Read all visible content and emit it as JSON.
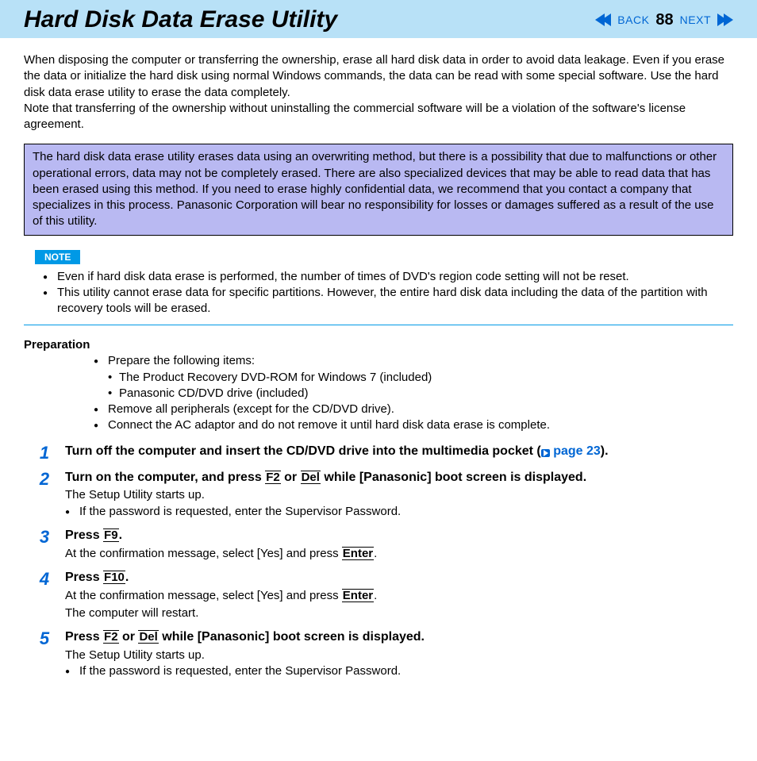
{
  "header": {
    "title": "Hard Disk Data Erase Utility",
    "back_label": "BACK",
    "page_number": "88",
    "next_label": "NEXT"
  },
  "intro_p1": "When disposing the computer or transferring the ownership, erase all hard disk data in order to avoid data leakage. Even if you erase the data or initialize the hard disk using normal Windows commands, the data can be read with some special software. Use the hard disk data erase utility to erase the data completely.",
  "intro_p2": "Note that transferring of the ownership without uninstalling the commercial software will be a violation of the software's license agreement.",
  "warning": "The hard disk data erase utility erases data using an overwriting method, but there is a possibility that due to malfunctions or other operational errors, data may not be completely erased. There are also specialized devices that may be able to read data that has been erased using this method. If you need to erase highly confidential data, we recommend that you contact a company that specializes in this process. Panasonic Corporation will bear no responsibility for losses or damages suffered as a result of the use of this utility.",
  "note_tag": "NOTE",
  "notes": [
    "Even if hard disk data erase is performed, the number of times of DVD's region code setting will not be reset.",
    "This utility cannot erase data for specific partitions. However, the entire hard disk data including the data of the partition with recovery tools will be erased."
  ],
  "prep": {
    "heading": "Preparation",
    "items_intro": "Prepare the following items:",
    "sub_items": [
      "The Product Recovery DVD-ROM for Windows 7 (included)",
      "Panasonic CD/DVD drive (included)"
    ],
    "item2": "Remove all peripherals (except for the CD/DVD drive).",
    "item3": "Connect the AC adaptor and do not remove it until hard disk data erase is complete."
  },
  "steps": {
    "s1": {
      "num": "1",
      "before_link": "Turn off the computer and insert the CD/DVD drive into the multimedia pocket (",
      "link_text": " page 23",
      "after_link": ")."
    },
    "s2": {
      "num": "2",
      "t_a": "Turn on the computer, and press ",
      "key1": "F2",
      "t_b": " or ",
      "key2": "Del",
      "t_c": " while [Panasonic] boot screen is displayed.",
      "sub1": "The Setup Utility starts up.",
      "sub2": "If the password is requested, enter the Supervisor Password."
    },
    "s3": {
      "num": "3",
      "t_a": "Press ",
      "key1": "F9",
      "t_b": ".",
      "sub_a": "At the confirmation message, select [Yes] and press ",
      "sub_key": "Enter",
      "sub_b": "."
    },
    "s4": {
      "num": "4",
      "t_a": "Press ",
      "key1": "F10",
      "t_b": ".",
      "sub_a": "At the confirmation message, select [Yes] and press ",
      "sub_key": "Enter",
      "sub_b": ".",
      "sub2": "The computer will restart."
    },
    "s5": {
      "num": "5",
      "t_a": "Press ",
      "key1": "F2",
      "t_b": " or ",
      "key2": "Del",
      "t_c": " while [Panasonic] boot screen is displayed.",
      "sub1": "The Setup Utility starts up.",
      "sub2": "If the password is requested, enter the Supervisor Password."
    }
  }
}
